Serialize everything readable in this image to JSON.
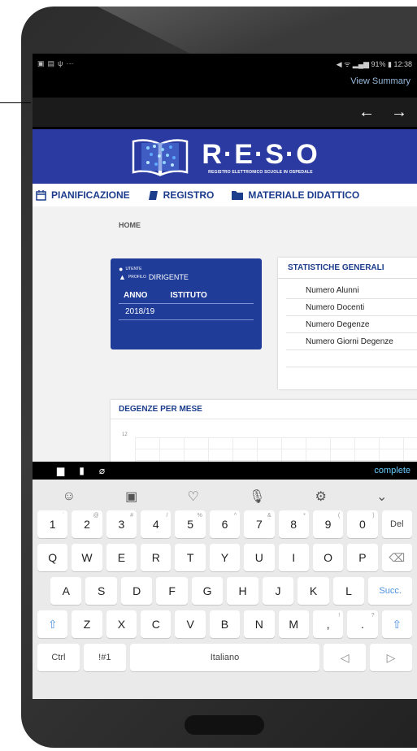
{
  "status": {
    "right": "◀ ᯤ ▂▄▆ 91% ▮ 12:38"
  },
  "app_bar": {
    "view_summary": "View Summary",
    "back_arrow": "←",
    "forward_arrow": "→"
  },
  "banner": {
    "title": "R·E·S·O",
    "subtitle": "REGISTRO ELETTRONICO SCUOLE IN OSPEDALE"
  },
  "nav": {
    "items": [
      "PIANIFICAZIONE",
      "REGISTRO",
      "MATERIALE DIDATTICO"
    ]
  },
  "breadcrumb": "HOME",
  "user_card": {
    "utente_label": "UTENTE",
    "profilo_label": "PROFILO",
    "profilo_value": "DIRIGENTE",
    "anno_label": "ANNO",
    "istituto_label": "ISTITUTO",
    "anno_value": "2018/19"
  },
  "stats": {
    "title": "STATISTICHE GENERALI",
    "items": [
      "Numero Alunni",
      "Numero Docenti",
      "Numero Degenze",
      "Numero Giorni Degenze"
    ]
  },
  "degenze": {
    "title": "DEGENZE PER MESE",
    "y_tick": "12"
  },
  "editor_toolbar": {
    "complete": "complete"
  },
  "keyboard": {
    "numbers": [
      [
        "1",
        "`"
      ],
      [
        "2",
        "@"
      ],
      [
        "3",
        "#"
      ],
      [
        "4",
        "/"
      ],
      [
        "5",
        "%"
      ],
      [
        "6",
        "^"
      ],
      [
        "7",
        "&"
      ],
      [
        "8",
        "*"
      ],
      [
        "9",
        "("
      ],
      [
        "0",
        ")"
      ]
    ],
    "del": "Del",
    "row1": [
      "Q",
      "W",
      "E",
      "R",
      "T",
      "Y",
      "U",
      "I",
      "O",
      "P"
    ],
    "row2": [
      "A",
      "S",
      "D",
      "F",
      "G",
      "H",
      "J",
      "K",
      "L"
    ],
    "succ": "Succ.",
    "row3": [
      "Z",
      "X",
      "C",
      "V",
      "B",
      "N",
      "M"
    ],
    "comma": ",",
    "comma_alt": "!",
    "period": ".",
    "period_alt": "?",
    "ctrl": "Ctrl",
    "sym": "!#1",
    "space": "Italiano"
  }
}
